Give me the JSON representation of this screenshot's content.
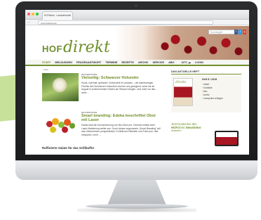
{
  "browser": {
    "tab_title": "HOFdirekt - Landwirtschaft",
    "url": "www.hofdirekt.de"
  },
  "header": {
    "logo_prefix": "HOF",
    "logo_main": "direkt",
    "search_placeholder": "Suchbegriff",
    "social": [
      "f",
      "t",
      "g"
    ]
  },
  "menu": {
    "items": [
      "START",
      "MELDUNGEN",
      "FRAGE&ANTWORT",
      "TERMINE",
      "REZEPTE",
      "ARCHIV",
      "SERVICE",
      "ABO"
    ],
    "active": "START",
    "weather": "34°C",
    "login": "LOGIN"
  },
  "breadcrumb": "> Start",
  "articles": [
    {
      "category": "NACHRICHTEN",
      "headline": "Vielseitig: Schwarzer Holunder",
      "teaser": "Kunst, nahrhaft, gebrannt: Vorhinzieht ihr schwarz – der kaemmerigen Früchte des Schwarzen Holunders sind bei uns genügend, wenn sie ab August in schimmernden Dolden am Strauch hängen. Und nicht nur das ... mehr ..."
    },
    {
      "category": "NACHRICHTEN",
      "headline": "Smart branding: Edeka beschriftet Obst mit Laser",
      "teaser": "Edeka baut die Kennzeichnung von Bio-Obst und -Gemüse mittels einer Laser-Markierung weiter aus. Durch dieses sogenannte „Smart Branding\" will das Unternehmen perspektivisch 10 Millionen Etiketten und Folien pro Jahr einsparen. mehr ..."
    }
  ],
  "bottom_headline": "Raffinierte Salate für das Grillbuffet",
  "sidebar": {
    "title": "DAS AKTUELLE HEFT",
    "cover_logo": "direkt",
    "issue": "Heft 5 / 2018",
    "links": [
      "Inhalt",
      "Kontakte",
      "Abo",
      "Archiv",
      "Leseprobe erfragen"
    ],
    "newsletter_line1": "Jetzt kostenlos den",
    "newsletter_line2_prefix": "HOF",
    "newsletter_line2_brand": "direkt",
    "newsletter_line2_suffix": "Newsletter",
    "newsletter_line3": "bestellen!"
  }
}
